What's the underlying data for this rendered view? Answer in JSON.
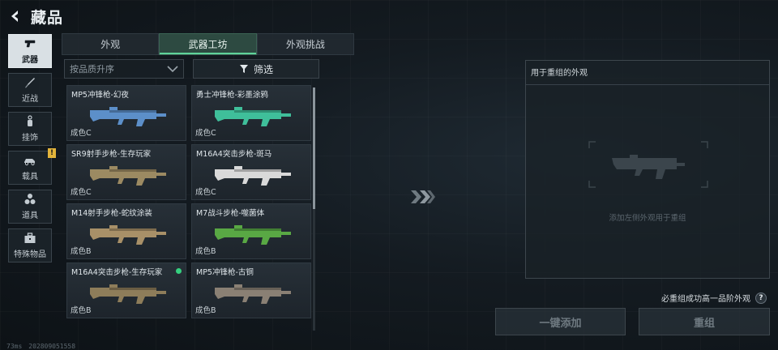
{
  "header": {
    "title": "藏品"
  },
  "sidebar": {
    "items": [
      {
        "label": "武器",
        "icon": "pistol-icon",
        "active": true
      },
      {
        "label": "近战",
        "icon": "knife-icon"
      },
      {
        "label": "挂饰",
        "icon": "charm-icon"
      },
      {
        "label": "载具",
        "icon": "vehicle-icon",
        "badge": "!"
      },
      {
        "label": "道具",
        "icon": "items-icon"
      },
      {
        "label": "特殊物品",
        "icon": "toolbox-icon"
      }
    ]
  },
  "tabs": [
    {
      "label": "外观"
    },
    {
      "label": "武器工坊",
      "active": true
    },
    {
      "label": "外观挑战"
    }
  ],
  "controls": {
    "sort_label": "按品质升序",
    "filter_label": "筛选"
  },
  "skins": [
    {
      "name": "MP5冲锋枪-幻夜",
      "quality": "成色C",
      "color": "#5c8fc9"
    },
    {
      "name": "勇士冲锋枪-彩墨涂鸦",
      "quality": "成色C",
      "color": "#3fbf9a"
    },
    {
      "name": "SR9射手步枪-生存玩家",
      "quality": "成色C",
      "color": "#9c8a62"
    },
    {
      "name": "M16A4突击步枪-斑马",
      "quality": "成色C",
      "color": "#d9d9d9"
    },
    {
      "name": "M14射手步枪-蛇纹涂装",
      "quality": "成色B",
      "color": "#a89068"
    },
    {
      "name": "M7战斗步枪-噬菌体",
      "quality": "成色B",
      "color": "#59a844"
    },
    {
      "name": "M16A4突击步枪-生存玩家",
      "quality": "成色B",
      "color": "#8e7d5a",
      "new": true
    },
    {
      "name": "MP5冲锋枪-古铜",
      "quality": "成色B",
      "color": "#8a8074"
    }
  ],
  "panel": {
    "title": "用于重组的外观",
    "slot_hint": "添加左侧外观用于重组"
  },
  "help": {
    "text": "必重组成功高一品阶外观",
    "icon_label": "?"
  },
  "buttons": {
    "add_label": "一键添加",
    "reassemble_label": "重组"
  },
  "footer": {
    "ping": "73ms",
    "build": "202809051558"
  }
}
